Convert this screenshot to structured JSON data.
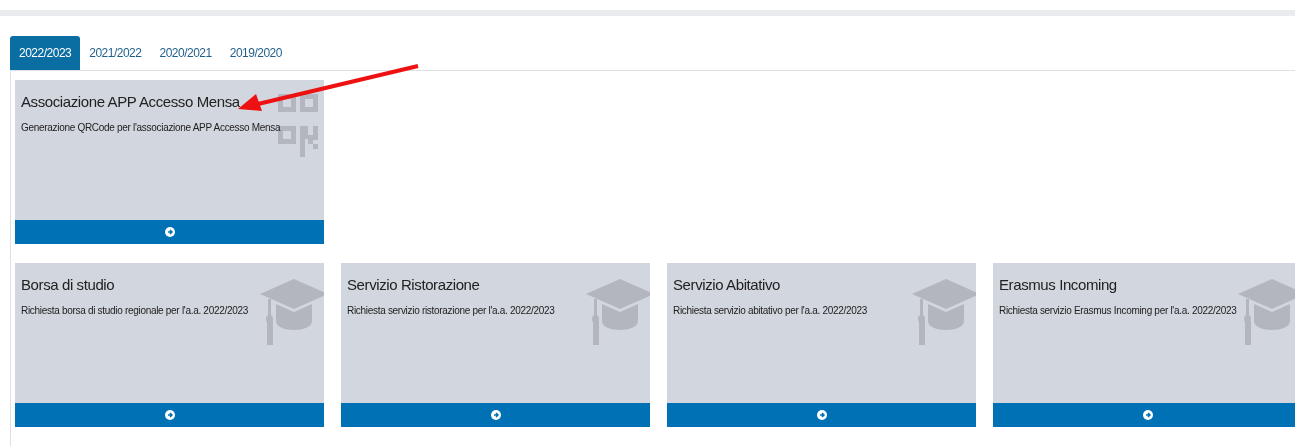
{
  "tabs": [
    {
      "label": "2022/2023",
      "selected": true
    },
    {
      "label": "2021/2022",
      "selected": false
    },
    {
      "label": "2020/2021",
      "selected": false
    },
    {
      "label": "2019/2020",
      "selected": false
    }
  ],
  "card_rows": [
    [
      {
        "title": "Associazione APP Accesso Mensa",
        "description": "Generazione QRCode per l'associazione APP Accesso Mensa",
        "kind": "qr"
      }
    ],
    [
      {
        "title": "Borsa di studio",
        "description": "Richiesta borsa di studio regionale per l'a.a. 2022/2023",
        "kind": "cap"
      },
      {
        "title": "Servizio Ristorazione",
        "description": "Richiesta servizio ristorazione per l'a.a. 2022/2023",
        "kind": "cap"
      },
      {
        "title": "Servizio Abitativo",
        "description": "Richiesta servizio abitativo per l'a.a. 2022/2023",
        "kind": "cap"
      },
      {
        "title": "Erasmus Incoming",
        "description": "Richiesta servizio Erasmus Incoming per l'a.a. 2022/2023",
        "kind": "cap"
      }
    ]
  ]
}
